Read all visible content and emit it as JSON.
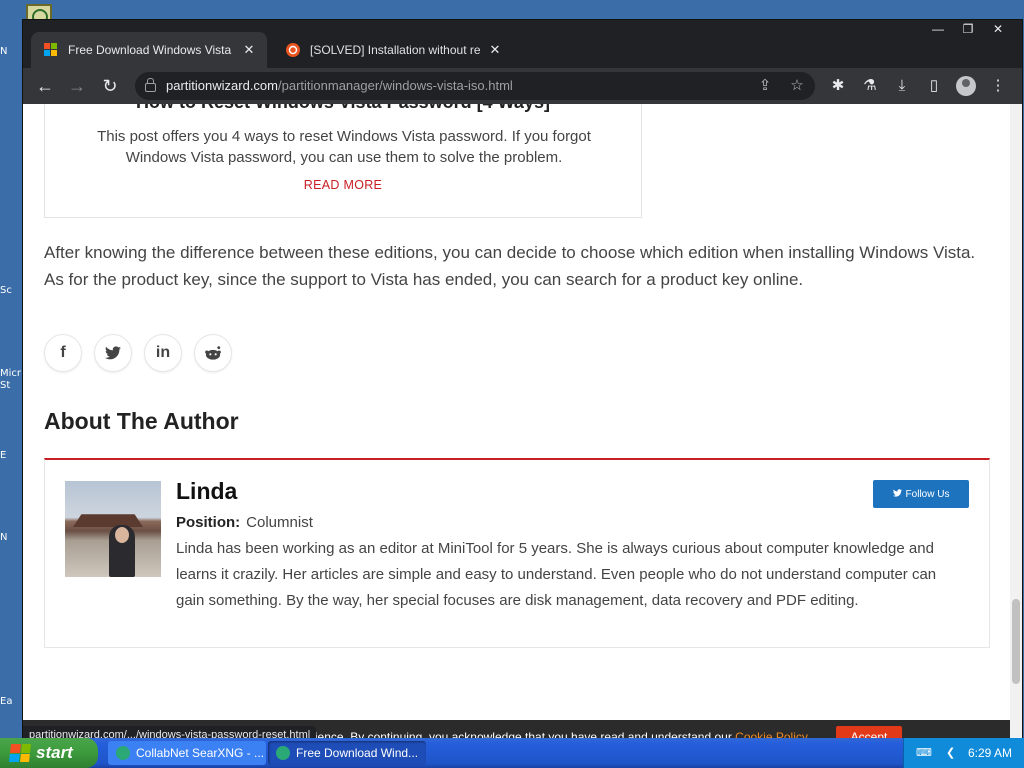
{
  "desktop": {
    "labels": [
      "N",
      "Sc",
      "Micr St",
      "E",
      "N",
      "Ea"
    ]
  },
  "browser": {
    "tabs": [
      {
        "title": "Free Download Windows Vista ISO",
        "active": true
      },
      {
        "title": "[SOLVED] Installation without reboot",
        "active": false
      }
    ],
    "url_host": "partitionwizard.com",
    "url_path": "/partitionmanager/windows-vista-iso.html"
  },
  "page": {
    "related": {
      "title": "How to Reset Windows Vista Password [4 Ways]",
      "description": "This post offers you 4 ways to reset Windows Vista password. If you forgot Windows Vista password, you can use them to solve the problem.",
      "read_more": "READ MORE"
    },
    "paragraph": "After knowing the difference between these editions, you can decide to choose which edition when installing Windows Vista. As for the product key, since the support to Vista has ended, you can search for a product key online.",
    "share_icons": [
      "facebook-icon",
      "twitter-icon",
      "linkedin-icon",
      "reddit-icon"
    ],
    "about_heading": "About The Author",
    "author": {
      "name": "Linda",
      "position_label": "Position:",
      "position_value": "Columnist",
      "bio": "Linda has been working as an editor at MiniTool for 5 years. She is always curious about computer knowledge and learns it crazily. Her articles are simple and easy to understand. Even people who do not understand computer can gain something. By the way, her special focuses are disk management, data recovery and PDF editing.",
      "follow_label": "Follow Us"
    },
    "cookie": {
      "text": "We use cookies to improve your experience. By continuing, you acknowledge that you have read and understand our",
      "link": "Cookie Policy",
      "suffix": ".",
      "accept": "Accept"
    },
    "status_url": "partitionwizard.com/.../windows-vista-password-reset.html"
  },
  "taskbar": {
    "start_label": "start",
    "tasks": [
      {
        "label": "CollabNet SearXNG - ..."
      },
      {
        "label": "Free Download Wind..."
      }
    ],
    "clock": "6:29 AM"
  },
  "colors": {
    "accent_red": "#c81e24",
    "follow_blue": "#1d73be",
    "cookie_link": "#f08a24",
    "accept_button": "#e23a19"
  }
}
